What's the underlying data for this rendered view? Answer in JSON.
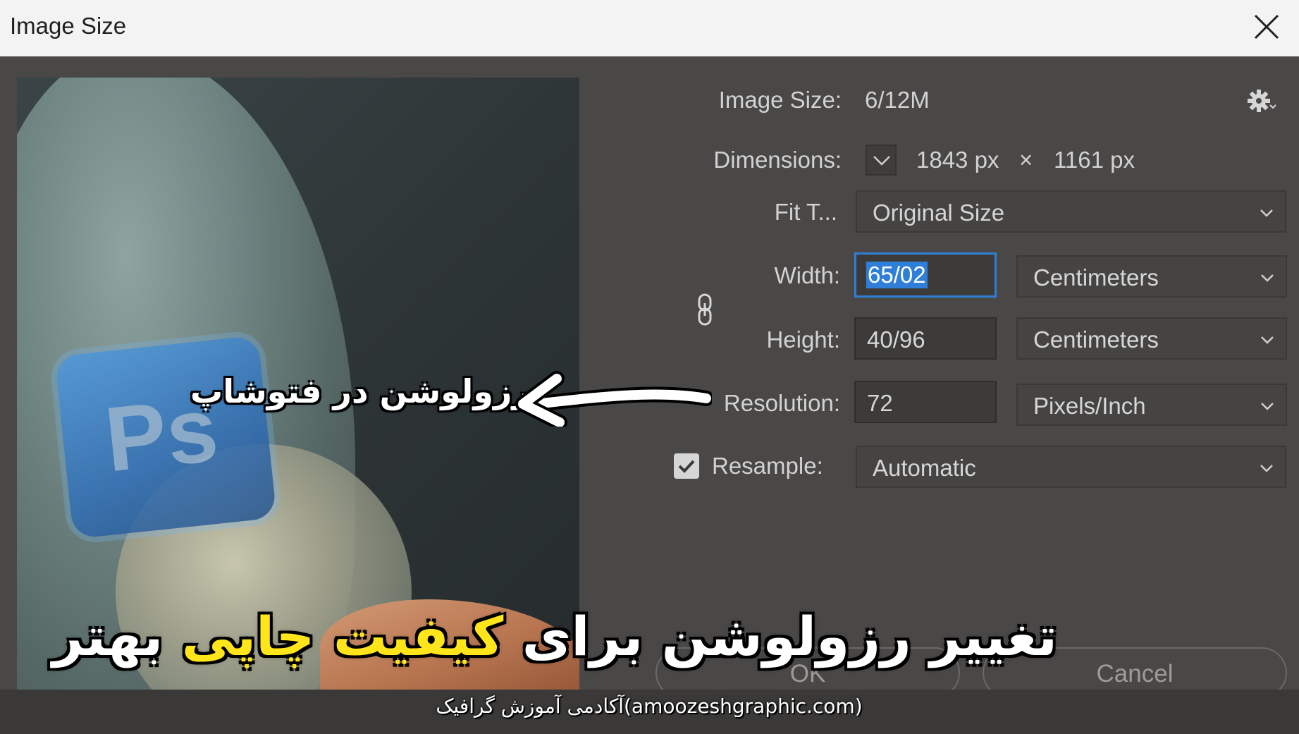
{
  "window": {
    "title": "Image Size"
  },
  "info": {
    "image_size_label": "Image Size:",
    "image_size_value": "6/12M",
    "dimensions_label": "Dimensions:",
    "dim_width": "1843 px",
    "dim_times": "×",
    "dim_height": "1161 px"
  },
  "fit_to": {
    "label": "Fit T...",
    "value": "Original Size"
  },
  "width": {
    "label": "Width:",
    "value": "65/02",
    "unit": "Centimeters"
  },
  "height": {
    "label": "Height:",
    "value": "40/96",
    "unit": "Centimeters"
  },
  "resolution": {
    "label": "Resolution:",
    "value": "72",
    "unit": "Pixels/Inch"
  },
  "resample": {
    "checked": true,
    "label": "Resample:",
    "value": "Automatic"
  },
  "buttons": {
    "ok": "OK",
    "cancel": "Cancel"
  },
  "preview": {
    "logo_text": "Ps"
  },
  "overlay": {
    "callout": "رزولوشن در فتوشاپ",
    "headline_part1": "تغییر رزولوشن برای ",
    "headline_highlight": "کیفیت چاپی",
    "headline_part2": " بهتر",
    "footer": "آکادمی آموزش گرافیک(amoozeshgraphic.com)"
  },
  "colors": {
    "dialog_bg": "#4a4847",
    "titlebar_bg": "#f3f3f3",
    "focus_blue": "#2f7ed8",
    "highlight_yellow": "#ffe51a"
  },
  "icons": {
    "close": "close-icon",
    "gear": "gear-icon",
    "chain": "link-chain-icon",
    "chevron": "chevron-down-icon",
    "check": "checkmark-icon"
  }
}
